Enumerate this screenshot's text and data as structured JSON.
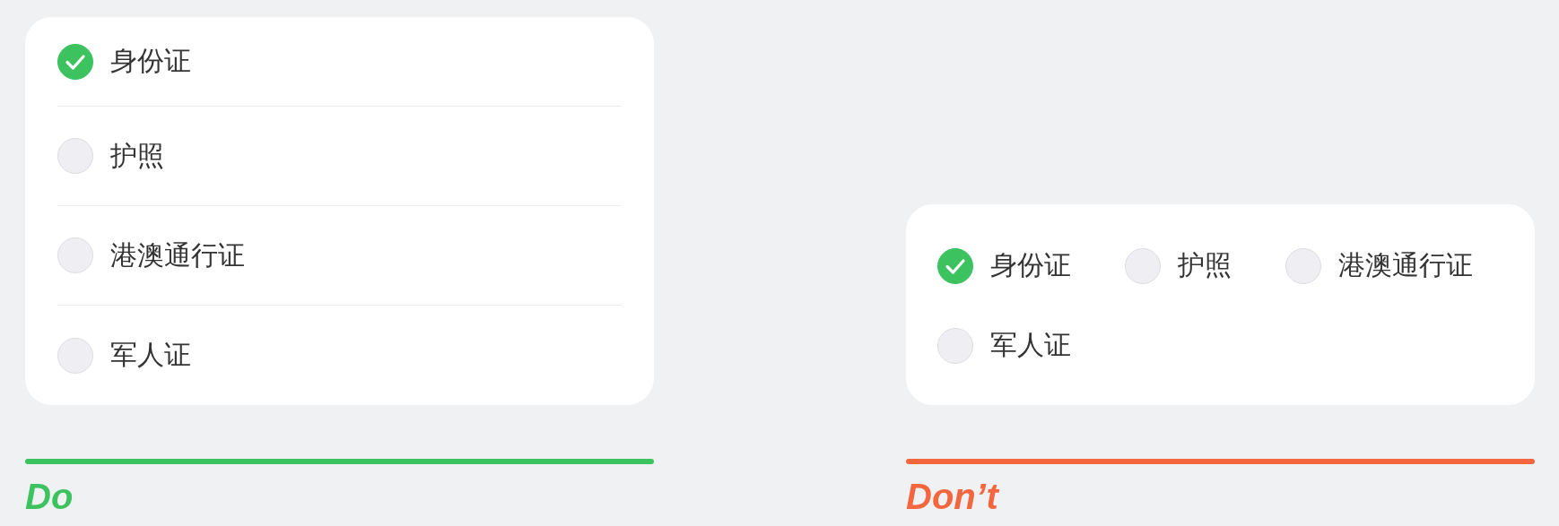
{
  "panels": [
    {
      "kind": "do",
      "label": "Do",
      "color": "#3cc35f",
      "options": [
        {
          "label": "身份证",
          "selected": true
        },
        {
          "label": "护照",
          "selected": false
        },
        {
          "label": "港澳通行证",
          "selected": false
        },
        {
          "label": "军人证",
          "selected": false
        }
      ]
    },
    {
      "kind": "dont",
      "label": "Don’t",
      "color": "#f4673e",
      "options": [
        {
          "label": "身份证",
          "selected": true
        },
        {
          "label": "护照",
          "selected": false
        },
        {
          "label": "港澳通行证",
          "selected": false
        },
        {
          "label": "军人证",
          "selected": false
        }
      ]
    }
  ]
}
